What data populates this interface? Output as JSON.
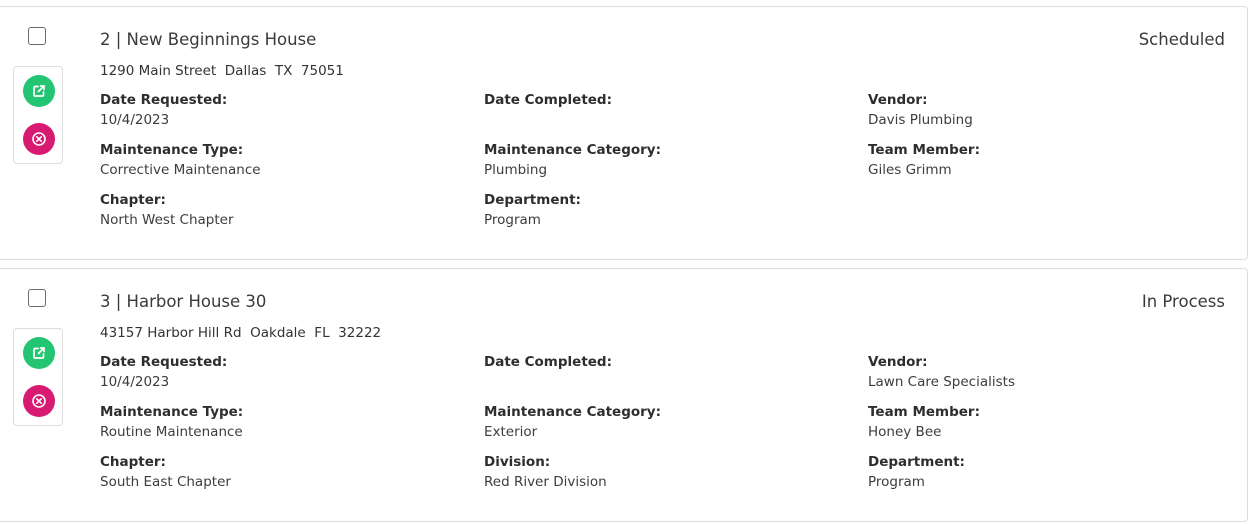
{
  "records": [
    {
      "title": "2 | New Beginnings House",
      "status": "Scheduled",
      "address": "1290 Main Street  Dallas  TX  75051",
      "fields": {
        "r1c1": {
          "label": "Date Requested:",
          "value": "10/4/2023"
        },
        "r1c2": {
          "label": "Date Completed:",
          "value": ""
        },
        "r1c3": {
          "label": "Vendor:",
          "value": "Davis Plumbing"
        },
        "r2c1": {
          "label": "Maintenance Type:",
          "value": "Corrective Maintenance"
        },
        "r2c2": {
          "label": "Maintenance Category:",
          "value": "Plumbing"
        },
        "r2c3": {
          "label": "Team Member:",
          "value": "Giles Grimm"
        },
        "r3c1": {
          "label": "Chapter:",
          "value": "North West Chapter"
        },
        "r3c2": {
          "label": "Department:",
          "value": "Program"
        }
      }
    },
    {
      "title": "3 | Harbor House 30",
      "status": "In Process",
      "address": "43157 Harbor Hill Rd  Oakdale  FL  32222",
      "fields": {
        "r1c1": {
          "label": "Date Requested:",
          "value": "10/4/2023"
        },
        "r1c2": {
          "label": "Date Completed:",
          "value": ""
        },
        "r1c3": {
          "label": "Vendor:",
          "value": "Lawn Care Specialists"
        },
        "r2c1": {
          "label": "Maintenance Type:",
          "value": "Routine Maintenance"
        },
        "r2c2": {
          "label": "Maintenance Category:",
          "value": "Exterior"
        },
        "r2c3": {
          "label": "Team Member:",
          "value": "Honey Bee"
        },
        "r3c1": {
          "label": "Chapter:",
          "value": "South East Chapter"
        },
        "r3c2": {
          "label": "Division:",
          "value": "Red River Division"
        },
        "r3c3": {
          "label": "Department:",
          "value": "Program"
        }
      }
    }
  ],
  "icons": {
    "open": "external-link-icon",
    "delete": "circle-x-icon"
  },
  "colors": {
    "open_button": "#23c472",
    "delete_button": "#d81b72"
  }
}
